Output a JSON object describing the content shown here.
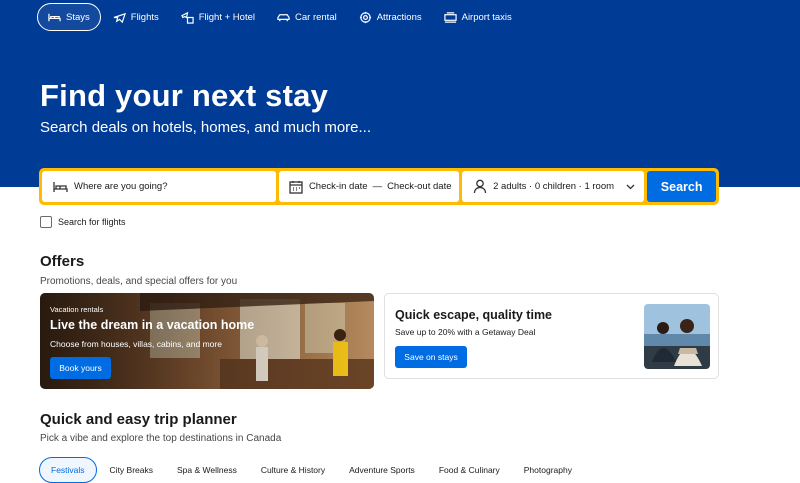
{
  "nav": {
    "items": [
      {
        "label": "Stays",
        "icon": "bed-icon",
        "active": true
      },
      {
        "label": "Flights",
        "icon": "plane-icon",
        "active": false
      },
      {
        "label": "Flight + Hotel",
        "icon": "flight-hotel-icon",
        "active": false
      },
      {
        "label": "Car rental",
        "icon": "car-icon",
        "active": false
      },
      {
        "label": "Attractions",
        "icon": "attractions-icon",
        "active": false
      },
      {
        "label": "Airport taxis",
        "icon": "taxi-icon",
        "active": false
      }
    ]
  },
  "hero": {
    "title": "Find your next stay",
    "subtitle": "Search deals on hotels, homes, and much more..."
  },
  "search": {
    "destination_placeholder": "Where are you going?",
    "checkin_label": "Check-in date",
    "separator": "—",
    "checkout_label": "Check-out date",
    "guests_label": "2 adults · 0 children · 1 room",
    "button_label": "Search",
    "flights_checkbox_label": "Search for flights",
    "flights_checkbox_checked": false
  },
  "offers": {
    "title": "Offers",
    "subtitle": "Promotions, deals, and special offers for you",
    "cards": [
      {
        "tag": "Vacation rentals",
        "heading": "Live the dream in a vacation home",
        "text": "Choose from houses, villas, cabins, and more",
        "button": "Book yours"
      },
      {
        "heading": "Quick escape, quality time",
        "text": "Save up to 20% with a Getaway Deal",
        "button": "Save on stays"
      }
    ]
  },
  "planner": {
    "title": "Quick and easy trip planner",
    "subtitle": "Pick a vibe and explore the top destinations in Canada",
    "chips": [
      "Festivals",
      "City Breaks",
      "Spa & Wellness",
      "Culture & History",
      "Adventure Sports",
      "Food & Culinary",
      "Photography"
    ],
    "active_chip": "Festivals"
  },
  "colors": {
    "hero_bg": "#003b95",
    "search_border": "#febb02",
    "primary_button": "#006ce4"
  }
}
